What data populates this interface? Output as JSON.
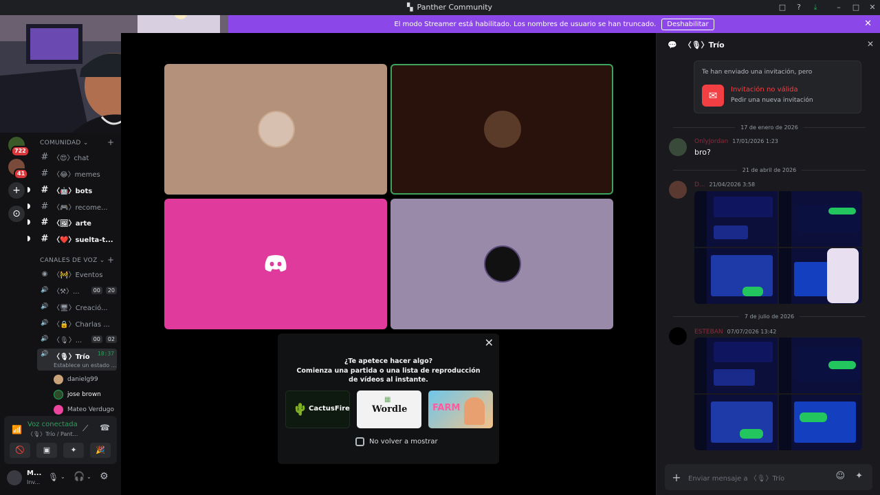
{
  "window": {
    "title": "Panther Community",
    "controls": [
      "□",
      "?",
      "⤓",
      "–",
      "□",
      "✕"
    ]
  },
  "banner": {
    "text": "El modo Streamer está habilitado. Los nombres de usuario se han truncado.",
    "button": "Deshabilitar",
    "close": "✕"
  },
  "servers": [
    {
      "badge": "722",
      "color": "#3a5a2a"
    },
    {
      "badge": "41",
      "color": "#7a4a3a"
    }
  ],
  "server_actions": {
    "add": "+",
    "discover": "⊙"
  },
  "sidebar": {
    "categories": [
      {
        "label": "COMUNIDAD ⌄",
        "plus": "+"
      },
      {
        "label": "CANALES DE VOZ ⌄",
        "plus": "+"
      }
    ],
    "text_channels": [
      {
        "label": "〈😍〉chat",
        "bold": false,
        "unread": false
      },
      {
        "label": "〈😂〉memes",
        "bold": false,
        "unread": false
      },
      {
        "label": "〈🤖〉bots",
        "bold": true,
        "unread": true
      },
      {
        "label": "〈🎮〉recome...",
        "bold": false,
        "unread": true
      },
      {
        "label": "〈🖼〉arte",
        "bold": true,
        "unread": true
      },
      {
        "label": "〈❤️〉suelta-t...",
        "bold": true,
        "unread": true
      }
    ],
    "voice_channels": [
      {
        "icon": "◉",
        "label": "〈🚧〉Eventos",
        "pills": []
      },
      {
        "icon": "🔊",
        "label": "〈⚒〉...",
        "pills": [
          "00",
          "20"
        ]
      },
      {
        "icon": "🔊",
        "label": "〈🖥〉Creació...",
        "pills": []
      },
      {
        "icon": "🔊",
        "label": "〈🔒〉Charlas ...",
        "pills": []
      },
      {
        "icon": "🔊",
        "label": "〈🎙〉...",
        "pills": [
          "00",
          "02"
        ]
      }
    ],
    "active_channel": {
      "label": "〈🎙〉Trío",
      "time": "18:37",
      "status": "Establece un estado ..."
    },
    "members": [
      {
        "name": "danielg99",
        "color": "#c9a27a"
      },
      {
        "name": "jose brown",
        "color": "#2d4a2a"
      },
      {
        "name": "Mateo Verdugo",
        "color": "#eb459e"
      }
    ]
  },
  "voice_panel": {
    "title": "Voz conectada",
    "subtitle": "〈🎙〉Trío / Pant...",
    "buttons": [
      "🚫",
      "▣",
      "✦",
      "🎉"
    ]
  },
  "user_bar": {
    "name": "M...",
    "status": "Inv..."
  },
  "tiles": [
    {
      "bg": "#b3917a",
      "avatar": "#d8c0b0",
      "border": ""
    },
    {
      "bg": "#2a120c",
      "avatar": "#5a3a28",
      "border": "#3ba55d"
    },
    {
      "bg": "#e13a9d",
      "avatar": "",
      "border": ""
    },
    {
      "bg": "#9a8aaa",
      "avatar": "#111111",
      "border": ""
    }
  ],
  "activity_prompt": {
    "title": "¿Te apetece hacer algo?",
    "body": "Comienza una partida o una lista de reproducción de vídeos al instante.",
    "games": [
      {
        "label": "CactusFire",
        "bg": "#0e1a10",
        "color": "#ffffff"
      },
      {
        "label": "Wordle",
        "bg": "#f2f2f2",
        "color": "#111111"
      },
      {
        "label": "FARM",
        "bg": "#4cb0d8",
        "color": "#ff5aa0"
      }
    ],
    "checkbox": "No volver a mostrar",
    "close": "✕"
  },
  "chat": {
    "channel": "〈🎙〉Trío",
    "invite": {
      "label": "Te han enviado una invitación, pero",
      "title": "Invitación no válida",
      "subtitle": "Pedir una nueva invitación"
    },
    "dividers": [
      "17 de enero de 2026",
      "21 de abril de 2026",
      "7 de julio de 2026"
    ],
    "messages": [
      {
        "name": "OnlyJordan",
        "time": "17/01/2026 1:23",
        "text": "bro?",
        "avatar": "#3a4a3a"
      },
      {
        "name": "D...",
        "time": "21/04/2026 3:58",
        "text": "",
        "avatar": "#5a3a30"
      },
      {
        "name": "ESTEBAN",
        "time": "07/07/2026 13:42",
        "text": "",
        "avatar": "#000000"
      }
    ],
    "composer_placeholder": "Enviar mensaje a 〈🎙〉Trío"
  }
}
